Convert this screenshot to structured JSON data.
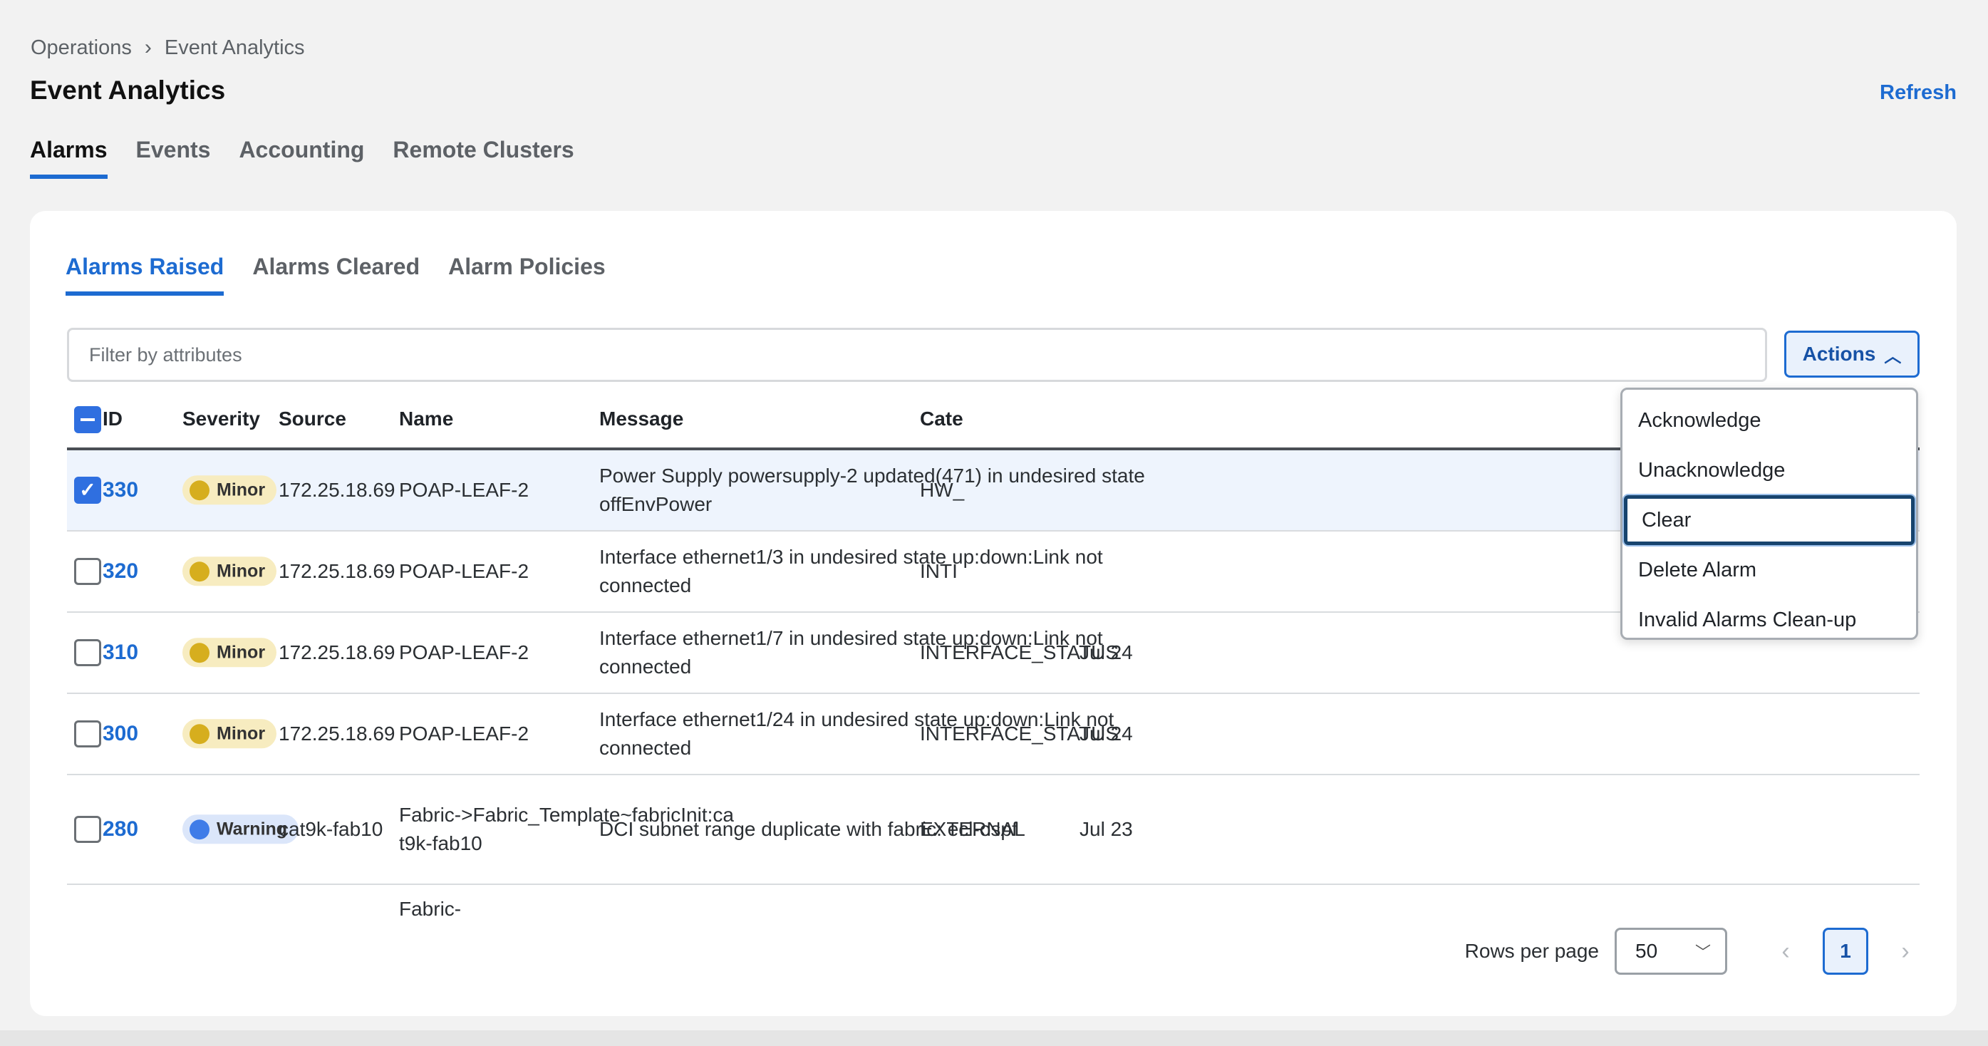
{
  "breadcrumb": {
    "parent": "Operations",
    "current": "Event Analytics"
  },
  "page": {
    "title": "Event Analytics",
    "refresh_label": "Refresh"
  },
  "main_tabs": [
    {
      "label": "Alarms",
      "active": true
    },
    {
      "label": "Events",
      "active": false
    },
    {
      "label": "Accounting",
      "active": false
    },
    {
      "label": "Remote Clusters",
      "active": false
    }
  ],
  "sub_tabs": [
    {
      "label": "Alarms Raised",
      "active": true
    },
    {
      "label": "Alarms Cleared",
      "active": false
    },
    {
      "label": "Alarm Policies",
      "active": false
    }
  ],
  "filter": {
    "placeholder": "Filter by attributes",
    "value": ""
  },
  "actions": {
    "label": "Actions",
    "menu": [
      "Acknowledge",
      "Unacknowledge",
      "Clear",
      "Delete Alarm",
      "Invalid Alarms Clean-up"
    ],
    "focused_item": "Clear"
  },
  "table": {
    "columns": [
      "ID",
      "Severity",
      "Source",
      "Name",
      "Message",
      "Cate",
      ""
    ],
    "rows": [
      {
        "id": "330",
        "checked": true,
        "severity": "Minor",
        "source": "172.25.18.69",
        "name": "POAP-LEAF-2",
        "message": "Power Supply powersupply-2 updated(471) in undesired state offEnvPower",
        "category": "HW_",
        "date": ""
      },
      {
        "id": "320",
        "checked": false,
        "severity": "Minor",
        "source": "172.25.18.69",
        "name": "POAP-LEAF-2",
        "message": "Interface ethernet1/3 in undesired state up:down:Link not connected",
        "category": "INTI",
        "date": ""
      },
      {
        "id": "310",
        "checked": false,
        "severity": "Minor",
        "source": "172.25.18.69",
        "name": "POAP-LEAF-2",
        "message": "Interface ethernet1/7 in undesired state up:down:Link not connected",
        "category": "INTERFACE_STATUS",
        "date": "Jul 24"
      },
      {
        "id": "300",
        "checked": false,
        "severity": "Minor",
        "source": "172.25.18.69",
        "name": "POAP-LEAF-2",
        "message": "Interface ethernet1/24 in undesired state up:down:Link not connected",
        "category": "INTERFACE_STATUS",
        "date": "Jul 24"
      },
      {
        "id": "280",
        "checked": false,
        "severity": "Warning",
        "source": "cat9k-fab10",
        "name": "Fabric->Fabric_Template~fabricInit:cat9k-fab10",
        "message": "DCI subnet range duplicate with fabric: ecl-ospf",
        "category": "EXTERNAL",
        "date": "Jul 23"
      }
    ],
    "partial_row_name": "Fabric-"
  },
  "pagination": {
    "rows_label": "Rows per page",
    "rows_value": "50",
    "current_page": "1",
    "prev_icon": "chevron-left-icon",
    "next_icon": "chevron-right-icon"
  },
  "colors": {
    "accent": "#1d6bd1",
    "minor": "#d6ae1e",
    "warning": "#3f7ce8"
  }
}
